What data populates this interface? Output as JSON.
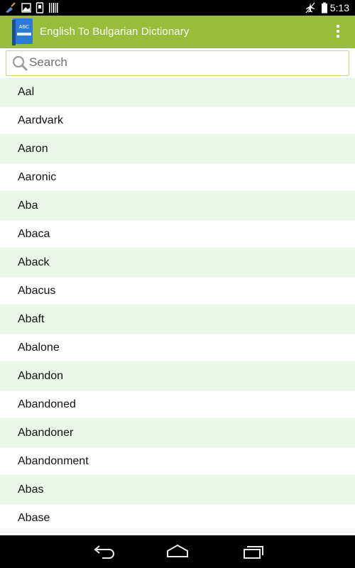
{
  "status_bar": {
    "time": "5:13",
    "left_icons": [
      "broom-icon",
      "image-icon",
      "phone-icon",
      "barcode-icon"
    ],
    "right_icons": [
      "airplane-mode-icon",
      "battery-icon"
    ]
  },
  "action_bar": {
    "title": "English To Bulgarian Dictionary",
    "icon_text": "ABC",
    "color": "#97bd3b"
  },
  "search": {
    "placeholder": "Search",
    "value": ""
  },
  "words": [
    "Aal",
    "Aardvark",
    "Aaron",
    "Aaronic",
    "Aba",
    "Abaca",
    "Aback",
    "Abacus",
    "Abaft",
    "Abalone",
    "Abandon",
    "Abandoned",
    "Abandoner",
    "Abandonment",
    "Abas",
    "Abase"
  ],
  "nav_bar": {
    "buttons": [
      "back-icon",
      "home-icon",
      "recents-icon"
    ]
  }
}
